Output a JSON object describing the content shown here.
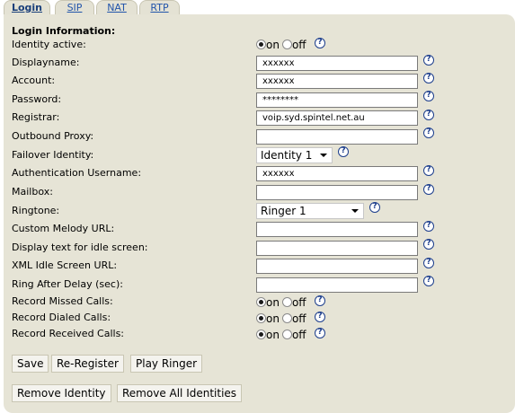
{
  "tabs": [
    {
      "label": "Login"
    },
    {
      "label": "SIP"
    },
    {
      "label": "NAT"
    },
    {
      "label": "RTP"
    }
  ],
  "section_title": "Login Information:",
  "help_glyph": "?",
  "radio_on": "on",
  "radio_off": "off",
  "labels": {
    "identity_active": "Identity active:",
    "displayname": "Displayname:",
    "account": "Account:",
    "password": "Password:",
    "registrar": "Registrar:",
    "outbound_proxy": "Outbound Proxy:",
    "failover_identity": "Failover Identity:",
    "auth_username": "Authentication Username:",
    "mailbox": "Mailbox:",
    "ringtone": "Ringtone:",
    "custom_melody_url": "Custom Melody URL:",
    "display_text_idle": "Display text for idle screen:",
    "xml_idle_url": "XML Idle Screen URL:",
    "ring_after_delay": "Ring After Delay (sec):",
    "record_missed": "Record Missed Calls:",
    "record_dialed": "Record Dialed Calls:",
    "record_received": "Record Received Calls:"
  },
  "values": {
    "identity_active": "on",
    "displayname": "xxxxxx",
    "account": "xxxxxx",
    "password": "********",
    "registrar": "voip.syd.spintel.net.au",
    "outbound_proxy": "",
    "failover_identity": "Identity 1",
    "auth_username": "xxxxxx",
    "mailbox": "",
    "ringtone": "Ringer 1",
    "custom_melody_url": "",
    "display_text_idle": "",
    "xml_idle_url": "",
    "ring_after_delay": "",
    "record_missed": "on",
    "record_dialed": "on",
    "record_received": "on"
  },
  "buttons": {
    "save": "Save",
    "re_register": "Re-Register",
    "play_ringer": "Play Ringer",
    "remove_identity": "Remove Identity",
    "remove_all": "Remove All Identities"
  }
}
